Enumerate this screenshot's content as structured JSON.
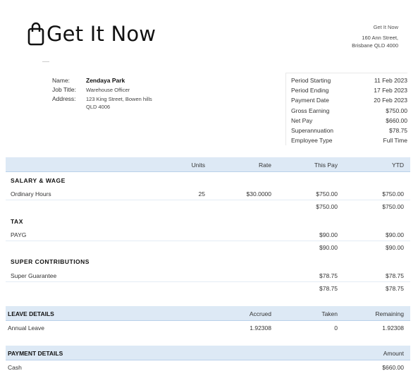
{
  "brand": {
    "name": "Get It Now"
  },
  "company": {
    "name": "Get It Now",
    "address_line1": "160 Ann Street,",
    "address_line2": "Brisbane QLD 4000"
  },
  "employee": {
    "name_label": "Name:",
    "name": "Zendaya Park",
    "job_label": "Job Title:",
    "job": "Warehouse Officer",
    "address_label": "Address:",
    "address_line1": "123 King Street, Bowen hills",
    "address_line2": "QLD 4006"
  },
  "period": [
    {
      "label": "Period Starting",
      "value": "11 Feb 2023"
    },
    {
      "label": "Period Ending",
      "value": "17 Feb 2023"
    },
    {
      "label": "Payment Date",
      "value": "20 Feb 2023"
    },
    {
      "label": "Gross Earning",
      "value": "$750.00"
    },
    {
      "label": "Net Pay",
      "value": "$660.00"
    },
    {
      "label": "Superannuation",
      "value": "$78.75"
    },
    {
      "label": "Employee Type",
      "value": "Full Time"
    }
  ],
  "earnings_header": {
    "units": "Units",
    "rate": "Rate",
    "this_pay": "This Pay",
    "ytd": "YTD"
  },
  "salary": {
    "title": "SALARY  &  WAGE",
    "rows": [
      {
        "label": "Ordinary Hours",
        "units": "25",
        "rate": "$30.0000",
        "this_pay": "$750.00",
        "ytd": "$750.00"
      }
    ],
    "total": {
      "this_pay": "$750.00",
      "ytd": "$750.00"
    }
  },
  "tax": {
    "title": "TAX",
    "rows": [
      {
        "label": "PAYG",
        "this_pay": "$90.00",
        "ytd": "$90.00"
      }
    ],
    "total": {
      "this_pay": "$90.00",
      "ytd": "$90.00"
    }
  },
  "super": {
    "title": "SUPER  CONTRIBUTIONS",
    "rows": [
      {
        "label": "Super Guarantee",
        "this_pay": "$78.75",
        "ytd": "$78.75"
      }
    ],
    "total": {
      "this_pay": "$78.75",
      "ytd": "$78.75"
    }
  },
  "leave": {
    "title": "LEAVE DETAILS",
    "accrued_label": "Accrued",
    "taken_label": "Taken",
    "remaining_label": "Remaining",
    "rows": [
      {
        "label": "Annual Leave",
        "accrued": "1.92308",
        "taken": "0",
        "remaining": "1.92308"
      }
    ]
  },
  "payment": {
    "title": "PAYMENT DETAILS",
    "amount_label": "Amount",
    "rows": [
      {
        "label": "Cash",
        "amount": "$660.00"
      }
    ]
  },
  "colors": {
    "header_bg": "#dde9f5",
    "header_border": "#b9d1ea"
  }
}
